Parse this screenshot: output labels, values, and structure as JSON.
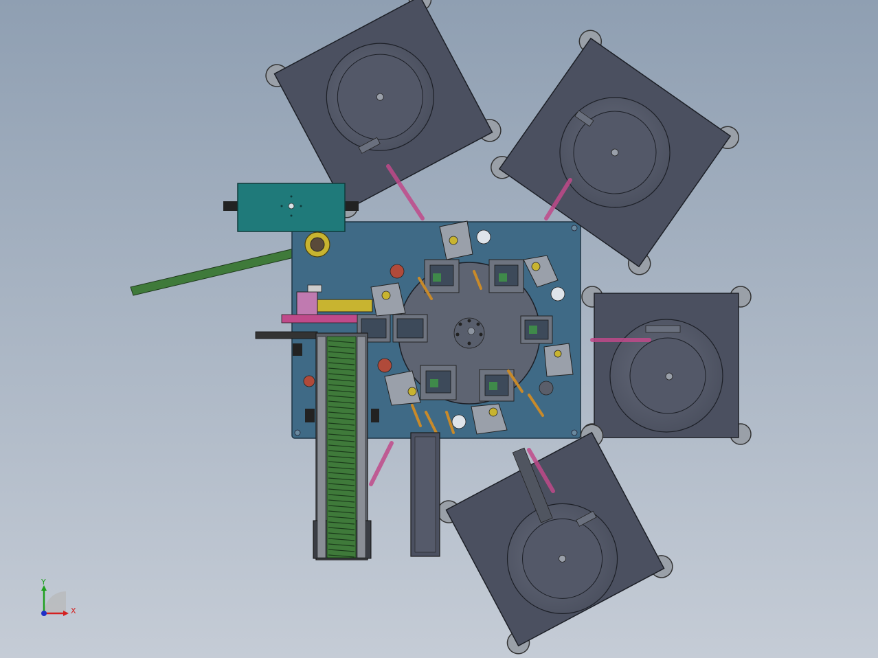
{
  "view": {
    "background_top": "#8f9fb2",
    "background_bottom": "#c5ccd6"
  },
  "triad": {
    "x_label": "X",
    "y_label": "Y",
    "x_color": "#d42020",
    "y_color": "#1ea01e",
    "z_color": "#2030c8"
  },
  "colors": {
    "feeder_body": "#4b5060",
    "feeder_bowl": "#575c6c",
    "base_plate": "#3f6a86",
    "motor_housing": "#1f7a7a",
    "rail": "#4a4a4a",
    "conveyor_green": "#3f7a3a",
    "accent_pink": "#c04a8a",
    "accent_yellow": "#c8b430",
    "accent_brown": "#8a4a2a"
  }
}
